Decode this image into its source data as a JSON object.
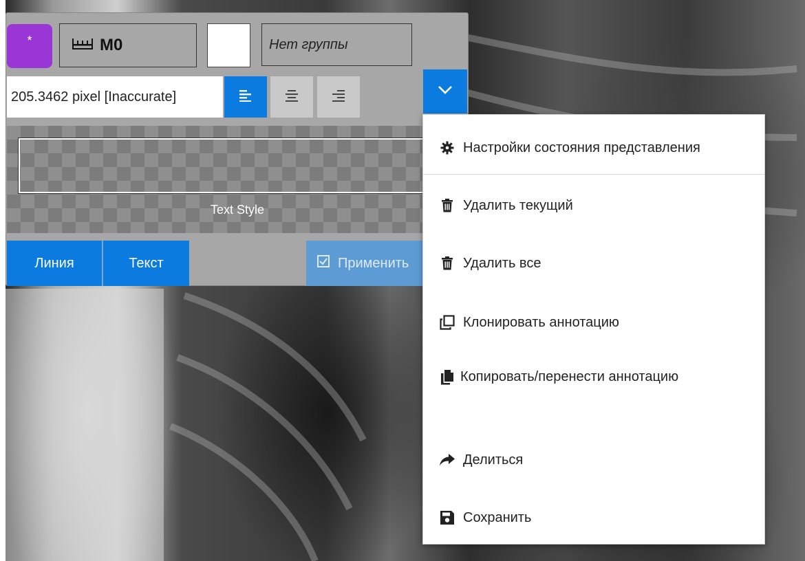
{
  "toolbar": {
    "star_label": "*",
    "measure_label": "M0",
    "group_placeholder": "Нет группы",
    "text_value": "205.3462 pixel [Inaccurate]",
    "text_style_label": "Text Style",
    "tab_line": "Линия",
    "tab_text": "Текст",
    "apply_label": "Применить",
    "colors": {
      "accent": "#0b7be0",
      "star": "#9a35d6",
      "panel": "#a7a7a7",
      "apply_disabled": "#5d9bd5"
    }
  },
  "menu": {
    "items": [
      {
        "icon": "gear-icon",
        "label": "Настройки состояния представления"
      },
      {
        "icon": "trash-icon",
        "label": "Удалить текущий"
      },
      {
        "icon": "trash-icon",
        "label": "Удалить все"
      },
      {
        "icon": "clone-icon",
        "label": "Клонировать аннотацию"
      },
      {
        "icon": "copy-icon",
        "label": "Копировать/перенести аннотацию"
      },
      {
        "icon": "share-icon",
        "label": "Делиться"
      },
      {
        "icon": "save-icon",
        "label": "Сохранить"
      }
    ]
  }
}
